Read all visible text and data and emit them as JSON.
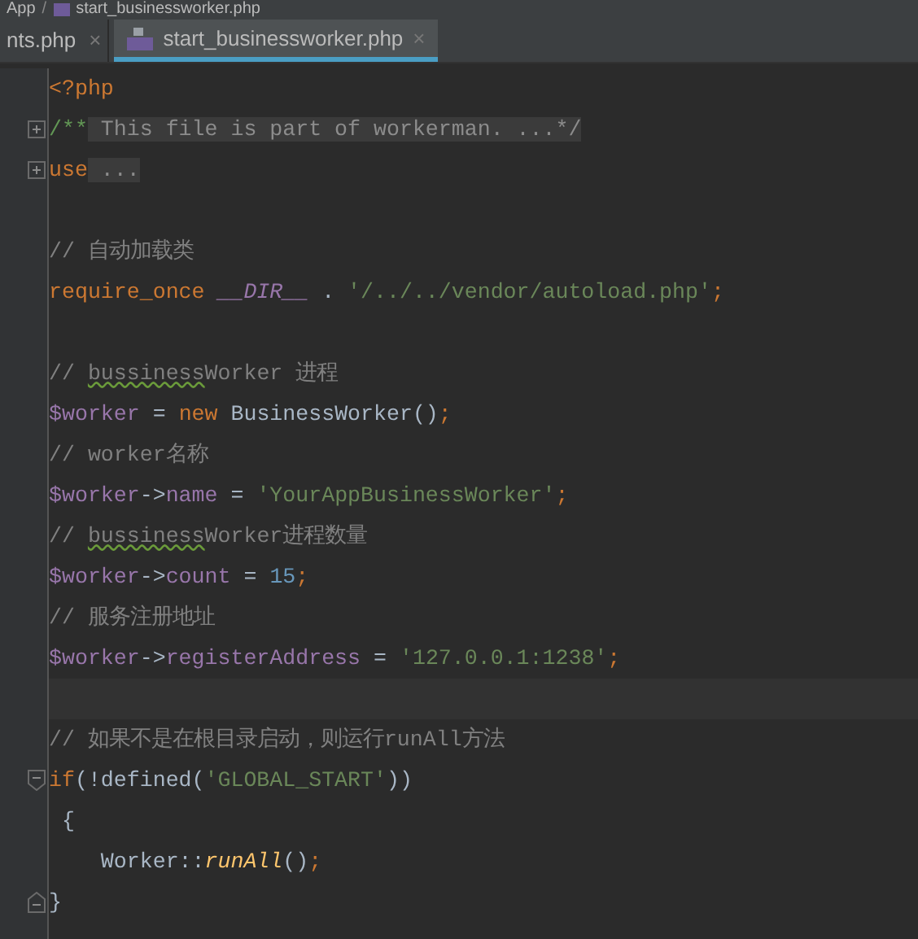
{
  "breadcrumb": [
    {
      "label": "App",
      "kind": "folder"
    },
    {
      "label": "start_businessworker.php",
      "kind": "php"
    }
  ],
  "breadcrumb_separator": "/",
  "tabs": [
    {
      "label": "nts.php",
      "selected": false,
      "kind": "plain",
      "close": "×"
    },
    {
      "label": "start_businessworker.php",
      "selected": true,
      "kind": "php",
      "close": "×"
    }
  ],
  "code_lines": [
    {
      "kind": "code",
      "tokens": [
        {
          "kind": "keyword",
          "text": "<?php"
        }
      ]
    },
    {
      "kind": "code",
      "fold": {
        "kind": "start",
        "expanded": false
      },
      "tokens": [
        {
          "kind": "doc",
          "text": "/**"
        },
        {
          "kind": "folded",
          "text": " This file is part of workerman. ...*/"
        }
      ]
    },
    {
      "kind": "code",
      "fold": {
        "kind": "start",
        "expanded": false
      },
      "tokens": [
        {
          "kind": "keyword",
          "text": "use"
        },
        {
          "kind": "folded",
          "text": " ..."
        }
      ]
    },
    {
      "kind": "blank"
    },
    {
      "kind": "code",
      "tokens": [
        {
          "kind": "comment",
          "text": "// 自动加载类"
        }
      ]
    },
    {
      "kind": "code",
      "tokens": [
        {
          "kind": "keyword",
          "text": "require_once "
        },
        {
          "kind": "constant",
          "text": "__DIR__"
        },
        {
          "kind": "plain",
          "text": " . "
        },
        {
          "kind": "string",
          "text": "'/../../vendor/autoload.php'"
        },
        {
          "kind": "keyword",
          "text": ";"
        }
      ]
    },
    {
      "kind": "blank"
    },
    {
      "kind": "code",
      "tokens": [
        {
          "kind": "comment",
          "text": "// "
        },
        {
          "kind": "typo",
          "text": "bussiness"
        },
        {
          "kind": "comment",
          "text": "Worker 进程"
        }
      ]
    },
    {
      "kind": "code",
      "tokens": [
        {
          "kind": "variable",
          "text": "$worker"
        },
        {
          "kind": "plain",
          "text": " = "
        },
        {
          "kind": "keyword",
          "text": "new "
        },
        {
          "kind": "plain",
          "text": "BusinessWorker()"
        },
        {
          "kind": "keyword",
          "text": ";"
        }
      ]
    },
    {
      "kind": "code",
      "tokens": [
        {
          "kind": "comment",
          "text": "// worker名称"
        }
      ]
    },
    {
      "kind": "code",
      "tokens": [
        {
          "kind": "variable",
          "text": "$worker"
        },
        {
          "kind": "plain",
          "text": "->"
        },
        {
          "kind": "variable",
          "text": "name"
        },
        {
          "kind": "plain",
          "text": " = "
        },
        {
          "kind": "string",
          "text": "'YourAppBusinessWorker'"
        },
        {
          "kind": "keyword",
          "text": ";"
        }
      ]
    },
    {
      "kind": "code",
      "tokens": [
        {
          "kind": "comment",
          "text": "// "
        },
        {
          "kind": "typo",
          "text": "bussiness"
        },
        {
          "kind": "comment",
          "text": "Worker进程数量"
        }
      ]
    },
    {
      "kind": "code",
      "tokens": [
        {
          "kind": "variable",
          "text": "$worker"
        },
        {
          "kind": "plain",
          "text": "->"
        },
        {
          "kind": "variable",
          "text": "count"
        },
        {
          "kind": "plain",
          "text": " = "
        },
        {
          "kind": "number",
          "text": "15"
        },
        {
          "kind": "keyword",
          "text": ";"
        }
      ]
    },
    {
      "kind": "code",
      "tokens": [
        {
          "kind": "comment",
          "text": "// 服务注册地址"
        }
      ]
    },
    {
      "kind": "code",
      "tokens": [
        {
          "kind": "variable",
          "text": "$worker"
        },
        {
          "kind": "plain",
          "text": "->"
        },
        {
          "kind": "variable",
          "text": "registerAddress"
        },
        {
          "kind": "plain",
          "text": " = "
        },
        {
          "kind": "string",
          "text": "'127.0.0.1:1238'"
        },
        {
          "kind": "keyword",
          "text": ";"
        }
      ]
    },
    {
      "kind": "blank",
      "current": true
    },
    {
      "kind": "code",
      "tokens": [
        {
          "kind": "comment",
          "text": "// 如果不是在根目录启动，则运行runAll方法"
        }
      ]
    },
    {
      "kind": "code",
      "fold": {
        "kind": "start",
        "expanded": true
      },
      "tokens": [
        {
          "kind": "keyword",
          "text": "if"
        },
        {
          "kind": "plain",
          "text": "(!defined("
        },
        {
          "kind": "string",
          "text": "'GLOBAL_START'"
        },
        {
          "kind": "plain",
          "text": "))"
        }
      ]
    },
    {
      "kind": "code",
      "tokens": [
        {
          "kind": "plain",
          "text": " {"
        }
      ]
    },
    {
      "kind": "code",
      "tokens": [
        {
          "kind": "plain",
          "text": "    Worker::"
        },
        {
          "kind": "function",
          "text": "runAll"
        },
        {
          "kind": "plain",
          "text": "()"
        },
        {
          "kind": "keyword",
          "text": ";"
        }
      ]
    },
    {
      "kind": "code",
      "fold": {
        "kind": "end",
        "expanded": true
      },
      "tokens": [
        {
          "kind": "plain",
          "text": "}"
        }
      ]
    }
  ]
}
